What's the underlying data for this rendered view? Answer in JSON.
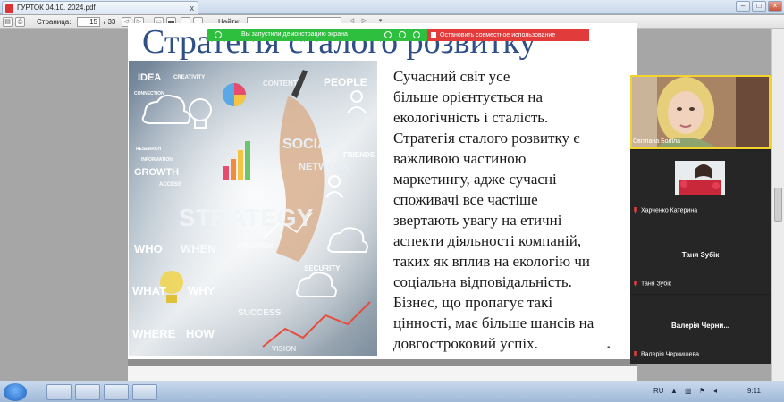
{
  "window": {
    "tab_title": "ГУРТОК 04.10. 2024.pdf",
    "tab_close": "x"
  },
  "toolbar": {
    "page_label": "Страница:",
    "page_current": "15",
    "page_total": "/ 33",
    "find_label": "Найти:"
  },
  "sharing": {
    "banner_text": "Вы запустили демонстрацию экрана",
    "stop_label": "Остановить совместное использование"
  },
  "slide": {
    "title": "Стратегія сталого розвитку",
    "text_lines": [
      "        Сучасний   світ   усе",
      "більше     орієнтується     на",
      "екологічність       і      сталість.",
      "Стратегія сталого розвитку є",
      "важливою               частиною",
      "маркетингу,     адже     сучасні",
      "споживачі       все       частіше",
      "звертають   увагу   на   етичні",
      "аспекти діяльності компаній,",
      "таких як вплив на екологію чи",
      "соціальна         відповідальність.",
      "Бізнес,    що    пропагує    такі",
      "цінності, має більше шансів на",
      "довгостроковий успіх."
    ],
    "collage_words": [
      "IDEA",
      "CREATIVITY",
      "CONTENT",
      "PEOPLE",
      "CONNECTION",
      "RESEARCH",
      "INFORMATION",
      "GROWTH",
      "ACCESS",
      "SOCIAL",
      "NETWORK",
      "FRIENDS",
      "STRATEGY",
      "WHO",
      "WHEN",
      "SOLUTION",
      "WHAT",
      "WHY",
      "SECURITY",
      "WHERE",
      "HOW",
      "SUCCESS",
      "VISION"
    ]
  },
  "participants": [
    {
      "name": "Світлана Боліла",
      "muted": false,
      "has_video": true,
      "speaking": true
    },
    {
      "name": "Харченко Катерина",
      "muted": true,
      "has_video": true
    },
    {
      "name": "Таня Зубік",
      "display": "Таня Зубік",
      "muted": true,
      "has_video": false
    },
    {
      "name": "Валерія Чернишева",
      "display": "Валерія Черни...",
      "muted": true,
      "has_video": false
    }
  ],
  "taskbar": {
    "language": "RU",
    "time": "9:11"
  },
  "colors": {
    "title_blue": "#2f4f87",
    "share_green": "#2fbf3f",
    "stop_red": "#e23b3b",
    "speaker_yellow": "#f1d22e"
  }
}
